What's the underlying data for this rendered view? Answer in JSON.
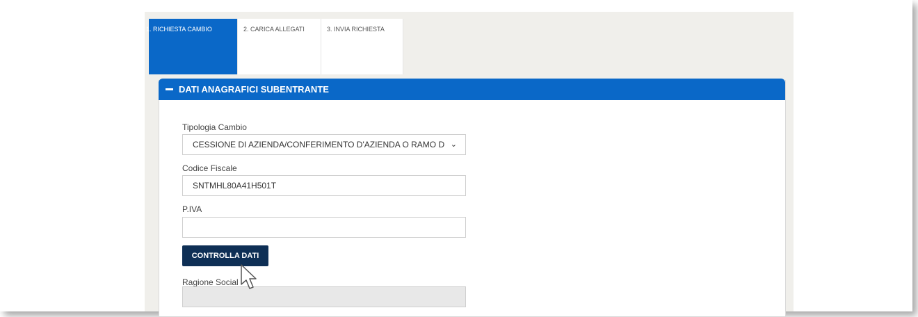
{
  "tabs": [
    {
      "label": "1. RICHIESTA CAMBIO",
      "active": true
    },
    {
      "label": "2. CARICA ALLEGATI",
      "active": false
    },
    {
      "label": "3. INVIA RICHIESTA",
      "active": false
    }
  ],
  "section": {
    "title": "DATI ANAGRAFICI SUBENTRANTE"
  },
  "form": {
    "tipologia_label": "Tipologia Cambio",
    "tipologia_value": "CESSIONE DI AZIENDA/CONFERIMENTO D'AZIENDA O RAMO D",
    "codice_label": "Codice Fiscale",
    "codice_value": "SNTMHL80A41H501T",
    "piva_label": "P.IVA",
    "piva_value": "",
    "check_button": "CONTROLLA DATI",
    "ragione_label": "Ragione Social",
    "ragione_value": ""
  },
  "colors": {
    "accent": "#0a68c8",
    "button": "#0e2f55"
  },
  "icons": [
    "minus-icon",
    "chevron-down-icon",
    "mouse-pointer-icon"
  ]
}
